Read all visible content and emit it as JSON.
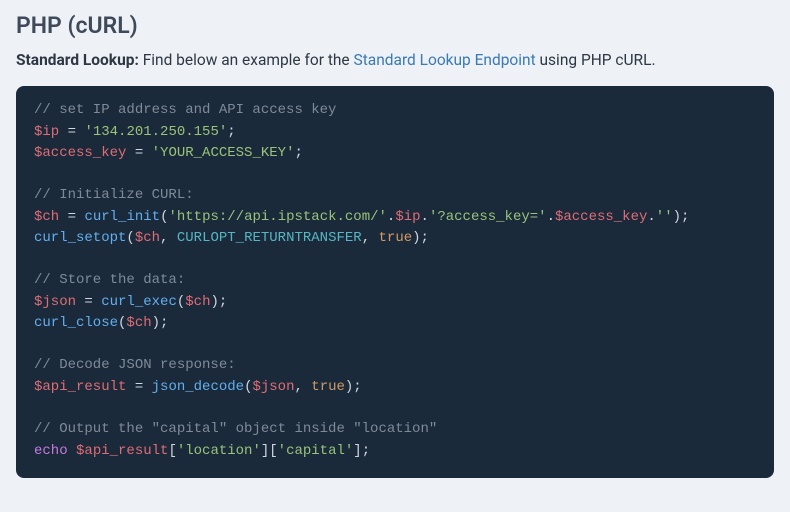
{
  "heading": "PHP (cURL)",
  "intro": {
    "bold": "Standard Lookup:",
    "before_link": " Find below an example for the ",
    "link_text": "Standard Lookup Endpoint",
    "after_link": " using PHP cURL."
  },
  "code": {
    "c1": "// set IP address and API access key",
    "l2_var": "$ip",
    "l2_eq": " = ",
    "l2_str": "'134.201.250.155'",
    "l2_semi": ";",
    "l3_var": "$access_key",
    "l3_eq": " = ",
    "l3_str": "'YOUR_ACCESS_KEY'",
    "l3_semi": ";",
    "c2": "// Initialize CURL:",
    "l5_var": "$ch",
    "l5_eq": " = ",
    "l5_fn": "curl_init",
    "l5_p1": "(",
    "l5_s1": "'https://api.ipstack.com/'",
    "l5_dot1": ".",
    "l5_v2": "$ip",
    "l5_dot2": ".",
    "l5_s2": "'?access_key='",
    "l5_dot3": ".",
    "l5_v3": "$access_key",
    "l5_dot4": ".",
    "l5_s3": "''",
    "l5_p2": ");",
    "l6_fn": "curl_setopt",
    "l6_p1": "(",
    "l6_v1": "$ch",
    "l6_c1": ", ",
    "l6_con": "CURLOPT_RETURNTRANSFER",
    "l6_c2": ", ",
    "l6_bl": "true",
    "l6_p2": ");",
    "c3": "// Store the data:",
    "l8_var": "$json",
    "l8_eq": " = ",
    "l8_fn": "curl_exec",
    "l8_p1": "(",
    "l8_v1": "$ch",
    "l8_p2": ");",
    "l9_fn": "curl_close",
    "l9_p1": "(",
    "l9_v1": "$ch",
    "l9_p2": ");",
    "c4": "// Decode JSON response:",
    "l11_var": "$api_result",
    "l11_eq": " = ",
    "l11_fn": "json_decode",
    "l11_p1": "(",
    "l11_v1": "$json",
    "l11_c1": ", ",
    "l11_bl": "true",
    "l11_p2": ");",
    "c5": "// Output the \"capital\" object inside \"location\"",
    "l13_kw": "echo",
    "l13_sp": " ",
    "l13_var": "$api_result",
    "l13_b1": "[",
    "l13_s1": "'location'",
    "l13_b2": "][",
    "l13_s2": "'capital'",
    "l13_b3": "];"
  }
}
